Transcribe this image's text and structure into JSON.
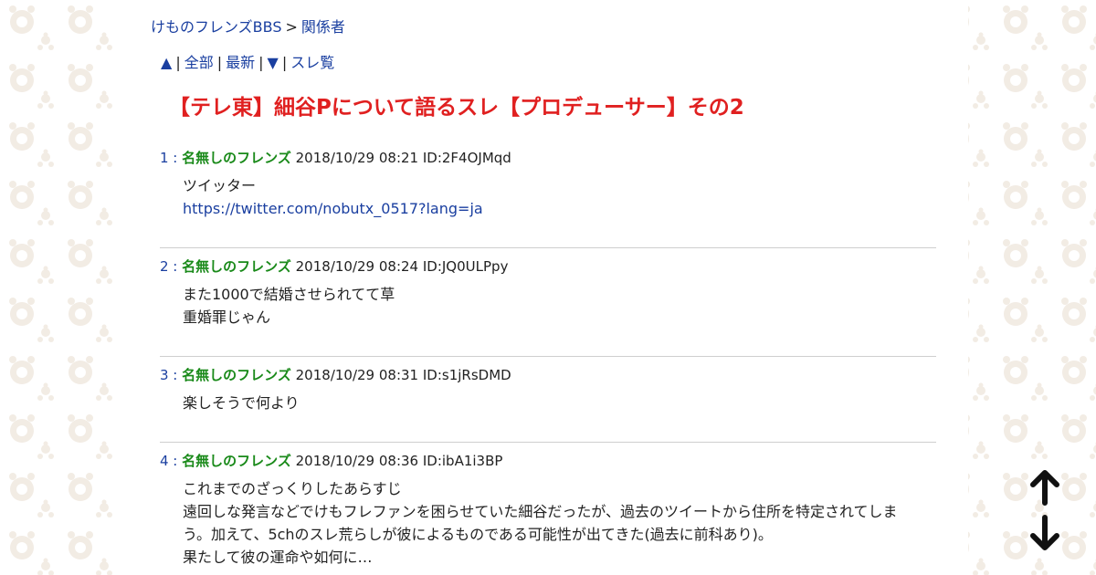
{
  "breadcrumb": {
    "board": "けものフレンズBBS",
    "separator": ">",
    "category": "関係者"
  },
  "nav": {
    "up": "▲",
    "all": "全部",
    "latest": "最新",
    "down": "▼",
    "thread_list": "スレ覧",
    "bar": "|"
  },
  "thread": {
    "title": "【テレ東】細谷Pについて語るスレ【プロデューサー】その2"
  },
  "posts": [
    {
      "num": "1 :",
      "name": "名無しのフレンズ",
      "meta": "2018/10/29 08:21 ID:2F4OJMqd",
      "lines": [
        "ツイッター"
      ],
      "link": "https://twitter.com/nobutx_0517?lang=ja"
    },
    {
      "num": "2 :",
      "name": "名無しのフレンズ",
      "meta": "2018/10/29 08:24 ID:JQ0ULPpy",
      "lines": [
        "また1000で結婚させられてて草",
        "重婚罪じゃん"
      ]
    },
    {
      "num": "3 :",
      "name": "名無しのフレンズ",
      "meta": "2018/10/29 08:31 ID:s1jRsDMD",
      "lines": [
        "楽しそうで何より"
      ]
    },
    {
      "num": "4 :",
      "name": "名無しのフレンズ",
      "meta": "2018/10/29 08:36 ID:ibA1i3BP",
      "lines": [
        "これまでのざっくりしたあらすじ",
        "遠回しな発言などでけもフレファンを困らせていた細谷だったが、過去のツイートから住所を特定されてしま",
        "う。加えて、5chのスレ荒らしが彼によるものである可能性が出てきた(過去に前科あり)。",
        "果たして彼の運命や如何に…"
      ]
    }
  ],
  "icons": {
    "scroll_up": "arrow-up-icon",
    "scroll_down": "arrow-down-icon",
    "background": "paw-pattern"
  },
  "colors": {
    "title": "#e02020",
    "name": "#1a8a1a",
    "link": "#1a3fa0",
    "pattern": "#f2ece4"
  }
}
